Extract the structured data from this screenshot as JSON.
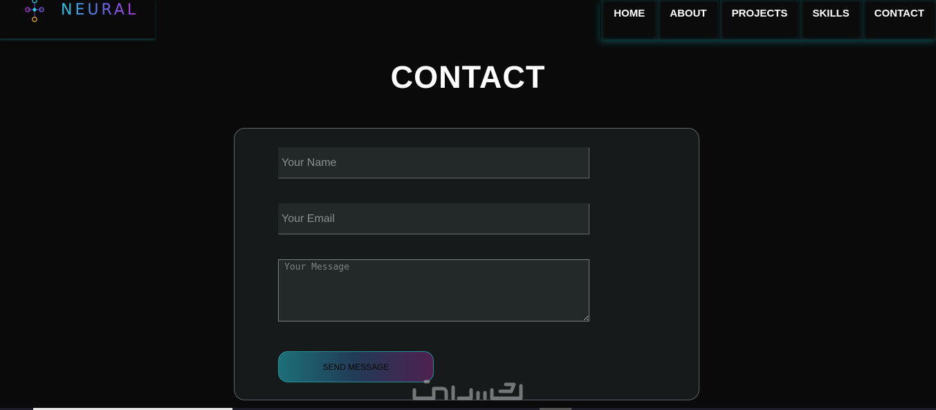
{
  "brand": {
    "logo_text": "NEURAL",
    "logo_icon": "network-nodes-icon"
  },
  "nav": {
    "items": [
      {
        "label": "HOME"
      },
      {
        "label": "ABOUT"
      },
      {
        "label": "PROJECTS"
      },
      {
        "label": "SKILLS"
      },
      {
        "label": "CONTACT"
      }
    ]
  },
  "main": {
    "title": "CONTACT"
  },
  "form": {
    "name_placeholder": "Your Name",
    "email_placeholder": "Your Email",
    "message_placeholder": "Your Message",
    "submit_label": "SEND MESSAGE"
  },
  "colors": {
    "background": "#0a0a0a",
    "card_background": "#161a1a",
    "input_background": "#232828",
    "accent_cyan": "#24c8e0",
    "accent_purple": "#b23ad8"
  }
}
